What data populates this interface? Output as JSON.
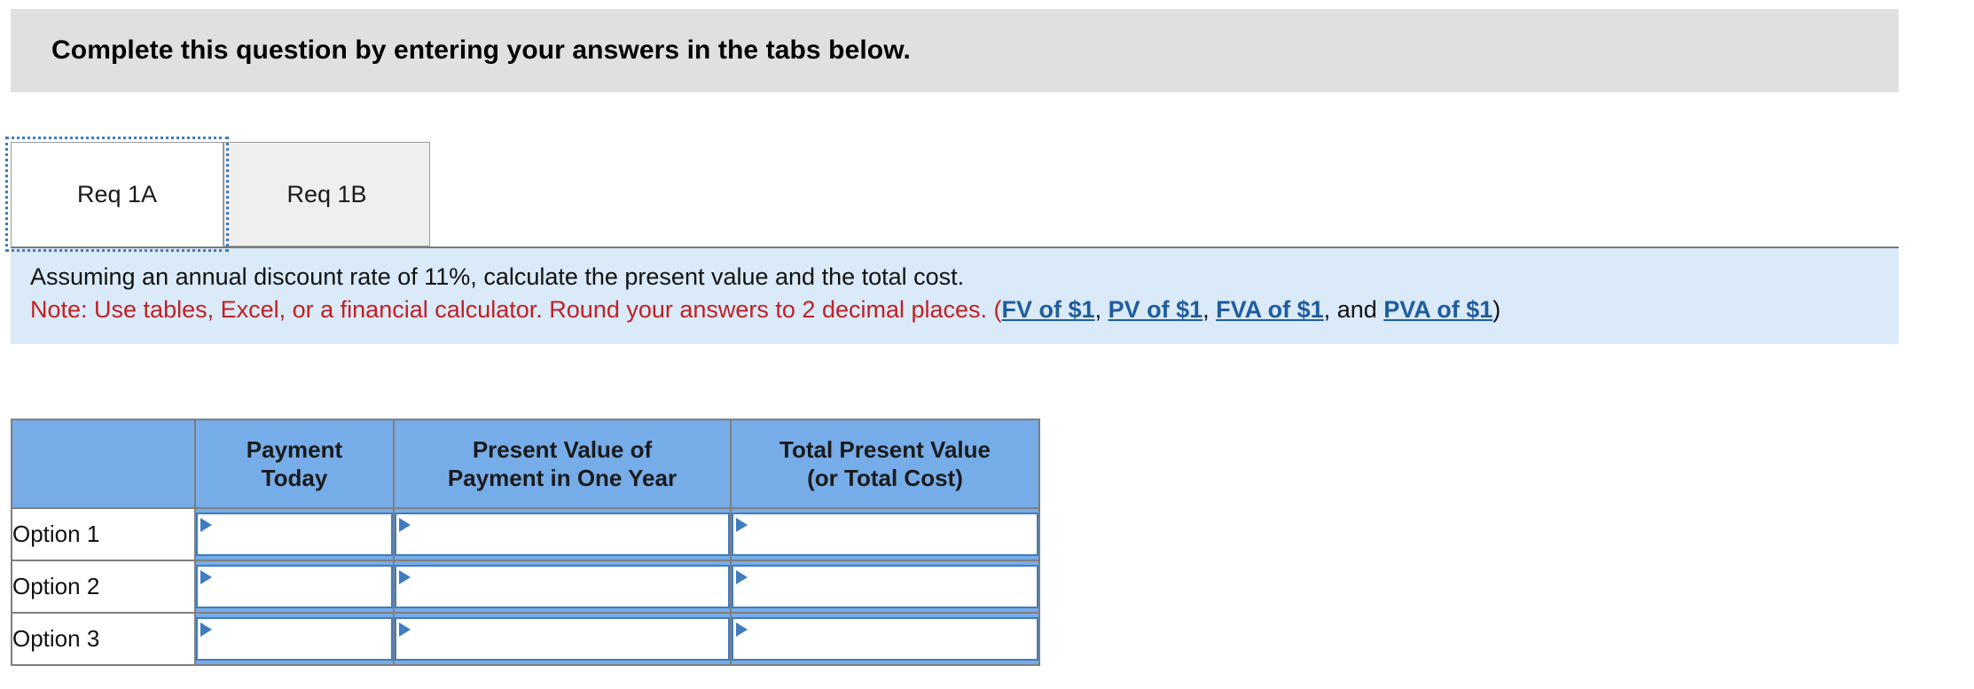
{
  "banner": {
    "title": "Complete this question by entering your answers in the tabs below."
  },
  "tabs": [
    {
      "label": "Req 1A",
      "active": true
    },
    {
      "label": "Req 1B",
      "active": false
    }
  ],
  "instructions": {
    "line1": "Assuming an annual discount rate of 11%, calculate the present value and the total cost.",
    "note_prefix": "Note: Use tables, Excel, or a financial calculator. Round your answers to 2 decimal places.",
    "paren_open": " (",
    "links": [
      "FV of $1",
      "PV of $1",
      "FVA of $1",
      "PVA of $1"
    ],
    "sep": ", ",
    "and_text": "and ",
    "paren_close": ")"
  },
  "table": {
    "headers": [
      "",
      "Payment\nToday",
      "Present Value of\nPayment in One Year",
      "Total Present Value\n(or Total Cost)"
    ],
    "header_lines": {
      "col1_line1": "Payment",
      "col1_line2": "Today",
      "col2_line1": "Present Value of",
      "col2_line2": "Payment in One Year",
      "col3_line1": "Total Present Value",
      "col3_line2": "(or Total Cost)"
    },
    "rows": [
      {
        "label": "Option 1",
        "payment_today": "",
        "pv_one_year": "",
        "total_pv": ""
      },
      {
        "label": "Option 2",
        "payment_today": "",
        "pv_one_year": "",
        "total_pv": ""
      },
      {
        "label": "Option 3",
        "payment_today": "",
        "pv_one_year": "",
        "total_pv": ""
      }
    ],
    "input_placeholder": ""
  },
  "colors": {
    "banner_bg": "#e0e0e0",
    "panel_bg": "#daeaf8",
    "header_blue": "#76ace8",
    "note_red": "#c02026",
    "link_blue": "#1f5c9e",
    "input_border": "#3f7cc0"
  }
}
